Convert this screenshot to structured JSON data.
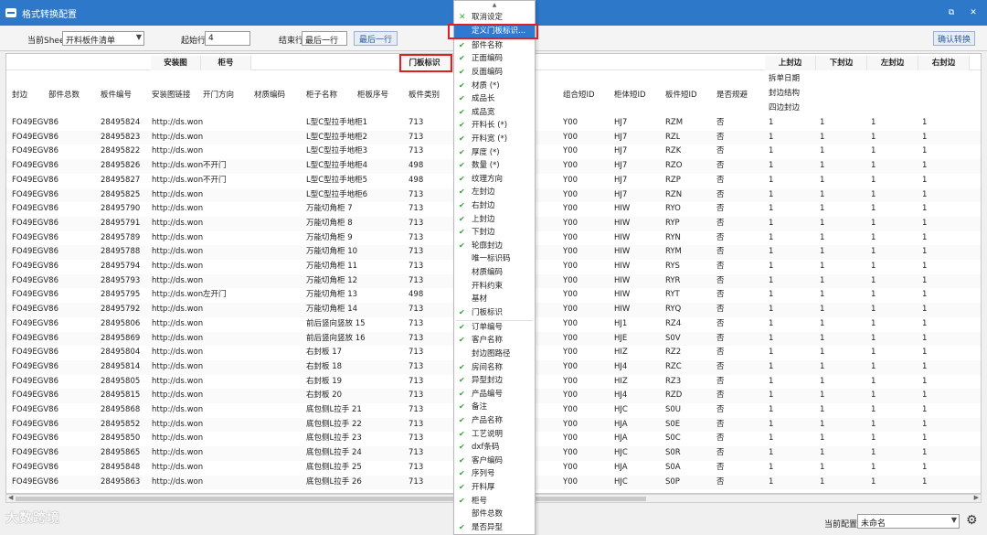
{
  "window": {
    "title": "格式转换配置",
    "restore": "⧉",
    "close": "✕"
  },
  "toolbar": {
    "sheet_label": "当前Sheet",
    "sheet_value": "开料板件清单",
    "start_label": "起始行",
    "start_value": "4",
    "end_label": "结束行",
    "end_value": "最后一行",
    "last_row_btn": "最后一行",
    "confirm_btn": "确认转换"
  },
  "grid": {
    "group_headers": [
      "安装图",
      "柜号",
      "门板标识",
      "上封边",
      "下封边",
      "左封边",
      "右封边"
    ],
    "side_labels": [
      "拆单日期",
      "封边结构",
      "四边封边"
    ],
    "columns": [
      "封边",
      "部件总数",
      "板件编号",
      "安装图链接",
      "开门方向",
      "材质编码",
      "柜子名称",
      "柜板序号",
      "板件类别",
      "组合短ID",
      "柜体短ID",
      "板件短ID",
      "是否规避"
    ],
    "rows": [
      [
        "FO49EGV86",
        "28495824",
        "http://ds.won",
        "",
        "L型C型拉手地柜1",
        "713",
        "Y00",
        "HJ7",
        "RZM",
        "否",
        "1",
        "1",
        "1",
        "1"
      ],
      [
        "FO49EGV86",
        "28495823",
        "http://ds.won",
        "",
        "L型C型拉手地柜2",
        "713",
        "Y00",
        "HJ7",
        "RZL",
        "否",
        "1",
        "1",
        "1",
        "1"
      ],
      [
        "FO49EGV86",
        "28495822",
        "http://ds.won",
        "",
        "L型C型拉手地柜3",
        "713",
        "Y00",
        "HJ7",
        "RZK",
        "否",
        "1",
        "1",
        "1",
        "1"
      ],
      [
        "FO49EGV86",
        "28495826",
        "http://ds.won",
        "不开门",
        "L型C型拉手地柜4",
        "498",
        "Y00",
        "HJ7",
        "RZO",
        "否",
        "1",
        "1",
        "1",
        "1"
      ],
      [
        "FO49EGV86",
        "28495827",
        "http://ds.won",
        "不开门",
        "L型C型拉手地柜5",
        "498",
        "Y00",
        "HJ7",
        "RZP",
        "否",
        "1",
        "1",
        "1",
        "1"
      ],
      [
        "FO49EGV86",
        "28495825",
        "http://ds.won",
        "",
        "L型C型拉手地柜6",
        "713",
        "Y00",
        "HJ7",
        "RZN",
        "否",
        "1",
        "1",
        "1",
        "1"
      ],
      [
        "FO49EGV86",
        "28495790",
        "http://ds.won",
        "",
        "万能切角柜 7",
        "713",
        "Y00",
        "HIW",
        "RYO",
        "否",
        "1",
        "1",
        "1",
        "1"
      ],
      [
        "FO49EGV86",
        "28495791",
        "http://ds.won",
        "",
        "万能切角柜 8",
        "713",
        "Y00",
        "HIW",
        "RYP",
        "否",
        "1",
        "1",
        "1",
        "1"
      ],
      [
        "FO49EGV86",
        "28495789",
        "http://ds.won",
        "",
        "万能切角柜 9",
        "713",
        "Y00",
        "HIW",
        "RYN",
        "否",
        "1",
        "1",
        "1",
        "1"
      ],
      [
        "FO49EGV86",
        "28495788",
        "http://ds.won",
        "",
        "万能切角柜 10",
        "713",
        "Y00",
        "HIW",
        "RYM",
        "否",
        "1",
        "1",
        "1",
        "1"
      ],
      [
        "FO49EGV86",
        "28495794",
        "http://ds.won",
        "",
        "万能切角柜 11",
        "713",
        "Y00",
        "HIW",
        "RYS",
        "否",
        "1",
        "1",
        "1",
        "1"
      ],
      [
        "FO49EGV86",
        "28495793",
        "http://ds.won",
        "",
        "万能切角柜 12",
        "713",
        "Y00",
        "HIW",
        "RYR",
        "否",
        "1",
        "1",
        "1",
        "1"
      ],
      [
        "FO49EGV86",
        "28495795",
        "http://ds.won",
        "左开门",
        "万能切角柜 13",
        "498",
        "Y00",
        "HIW",
        "RYT",
        "否",
        "1",
        "1",
        "1",
        "1"
      ],
      [
        "FO49EGV86",
        "28495792",
        "http://ds.won",
        "",
        "万能切角柜 14",
        "713",
        "Y00",
        "HIW",
        "RYQ",
        "否",
        "1",
        "1",
        "1",
        "1"
      ],
      [
        "FO49EGV86",
        "28495806",
        "http://ds.won",
        "",
        "前后竖向竖放 15",
        "713",
        "Y00",
        "HJ1",
        "RZ4",
        "否",
        "1",
        "1",
        "1",
        "1"
      ],
      [
        "FO49EGV86",
        "28495869",
        "http://ds.won",
        "",
        "前后竖向竖放 16",
        "713",
        "Y00",
        "HJE",
        "S0V",
        "否",
        "1",
        "1",
        "1",
        "1"
      ],
      [
        "FO49EGV86",
        "28495804",
        "http://ds.won",
        "",
        "右封板 17",
        "713",
        "Y00",
        "HIZ",
        "RZ2",
        "否",
        "1",
        "1",
        "1",
        "1"
      ],
      [
        "FO49EGV86",
        "28495814",
        "http://ds.won",
        "",
        "右封板 18",
        "713",
        "Y00",
        "HJ4",
        "RZC",
        "否",
        "1",
        "1",
        "1",
        "1"
      ],
      [
        "FO49EGV86",
        "28495805",
        "http://ds.won",
        "",
        "右封板 19",
        "713",
        "Y00",
        "HIZ",
        "RZ3",
        "否",
        "1",
        "1",
        "1",
        "1"
      ],
      [
        "FO49EGV86",
        "28495815",
        "http://ds.won",
        "",
        "右封板 20",
        "713",
        "Y00",
        "HJ4",
        "RZD",
        "否",
        "1",
        "1",
        "1",
        "1"
      ],
      [
        "FO49EGV86",
        "28495868",
        "http://ds.won",
        "",
        "底包侧L拉手 21",
        "713",
        "Y00",
        "HJC",
        "S0U",
        "否",
        "1",
        "1",
        "1",
        "1"
      ],
      [
        "FO49EGV86",
        "28495852",
        "http://ds.won",
        "",
        "底包侧L拉手 22",
        "713",
        "Y00",
        "HJA",
        "S0E",
        "否",
        "1",
        "1",
        "1",
        "1"
      ],
      [
        "FO49EGV86",
        "28495850",
        "http://ds.won",
        "",
        "底包侧L拉手 23",
        "713",
        "Y00",
        "HJA",
        "S0C",
        "否",
        "1",
        "1",
        "1",
        "1"
      ],
      [
        "FO49EGV86",
        "28495865",
        "http://ds.won",
        "",
        "底包侧L拉手 24",
        "713",
        "Y00",
        "HJC",
        "S0R",
        "否",
        "1",
        "1",
        "1",
        "1"
      ],
      [
        "FO49EGV86",
        "28495848",
        "http://ds.won",
        "",
        "底包侧L拉手 25",
        "713",
        "Y00",
        "HJA",
        "S0A",
        "否",
        "1",
        "1",
        "1",
        "1"
      ],
      [
        "FO49EGV86",
        "28495863",
        "http://ds.won",
        "",
        "底包侧L拉手 26",
        "713",
        "Y00",
        "HJC",
        "S0P",
        "否",
        "1",
        "1",
        "1",
        "1"
      ]
    ]
  },
  "menu": {
    "items": [
      {
        "label": "取消设定",
        "mark": "x"
      },
      {
        "label": "定义门板标识...",
        "mark": "",
        "selected": true
      },
      {
        "label": "部件名称",
        "mark": "check"
      },
      {
        "label": "正面编码",
        "mark": "check"
      },
      {
        "label": "反面编码",
        "mark": "check"
      },
      {
        "label": "材质 (*)",
        "mark": "check"
      },
      {
        "label": "成品长",
        "mark": "check"
      },
      {
        "label": "成品宽",
        "mark": "check"
      },
      {
        "label": "开料长 (*)",
        "mark": "check"
      },
      {
        "label": "开料宽 (*)",
        "mark": "check"
      },
      {
        "label": "厚度 (*)",
        "mark": "check"
      },
      {
        "label": "数量 (*)",
        "mark": "check"
      },
      {
        "label": "纹理方向",
        "mark": "check"
      },
      {
        "label": "左封边",
        "mark": "check"
      },
      {
        "label": "右封边",
        "mark": "check"
      },
      {
        "label": "上封边",
        "mark": "check"
      },
      {
        "label": "下封边",
        "mark": "check"
      },
      {
        "label": "轮廓封边",
        "mark": "check"
      },
      {
        "label": "唯一标识码",
        "mark": ""
      },
      {
        "label": "材质编码",
        "mark": ""
      },
      {
        "label": "开料约束",
        "mark": ""
      },
      {
        "label": "基材",
        "mark": ""
      },
      {
        "label": "门板标识",
        "mark": "check"
      },
      {
        "label": "订单编号",
        "mark": "check"
      },
      {
        "label": "客户名称",
        "mark": "check"
      },
      {
        "label": "封边图路径",
        "mark": ""
      },
      {
        "label": "房间名称",
        "mark": "check"
      },
      {
        "label": "异型封边",
        "mark": "check"
      },
      {
        "label": "产品编号",
        "mark": "check"
      },
      {
        "label": "备注",
        "mark": "check"
      },
      {
        "label": "产品名称",
        "mark": "check"
      },
      {
        "label": "工艺说明",
        "mark": "check"
      },
      {
        "label": "dxf条码",
        "mark": "check"
      },
      {
        "label": "客户编码",
        "mark": "check"
      },
      {
        "label": "序列号",
        "mark": "check"
      },
      {
        "label": "开料厚",
        "mark": "check"
      },
      {
        "label": "柜号",
        "mark": "check"
      },
      {
        "label": "部件总数",
        "mark": ""
      },
      {
        "label": "是否异型",
        "mark": "check"
      }
    ]
  },
  "status": {
    "config_label": "当前配置",
    "config_value": "未命名"
  },
  "watermark": "大数跨境",
  "colors": {
    "titlebar": "#2d78c8",
    "highlight": "#e02020",
    "check": "#2aa52a",
    "menu_selected": "#2f7ad0"
  }
}
